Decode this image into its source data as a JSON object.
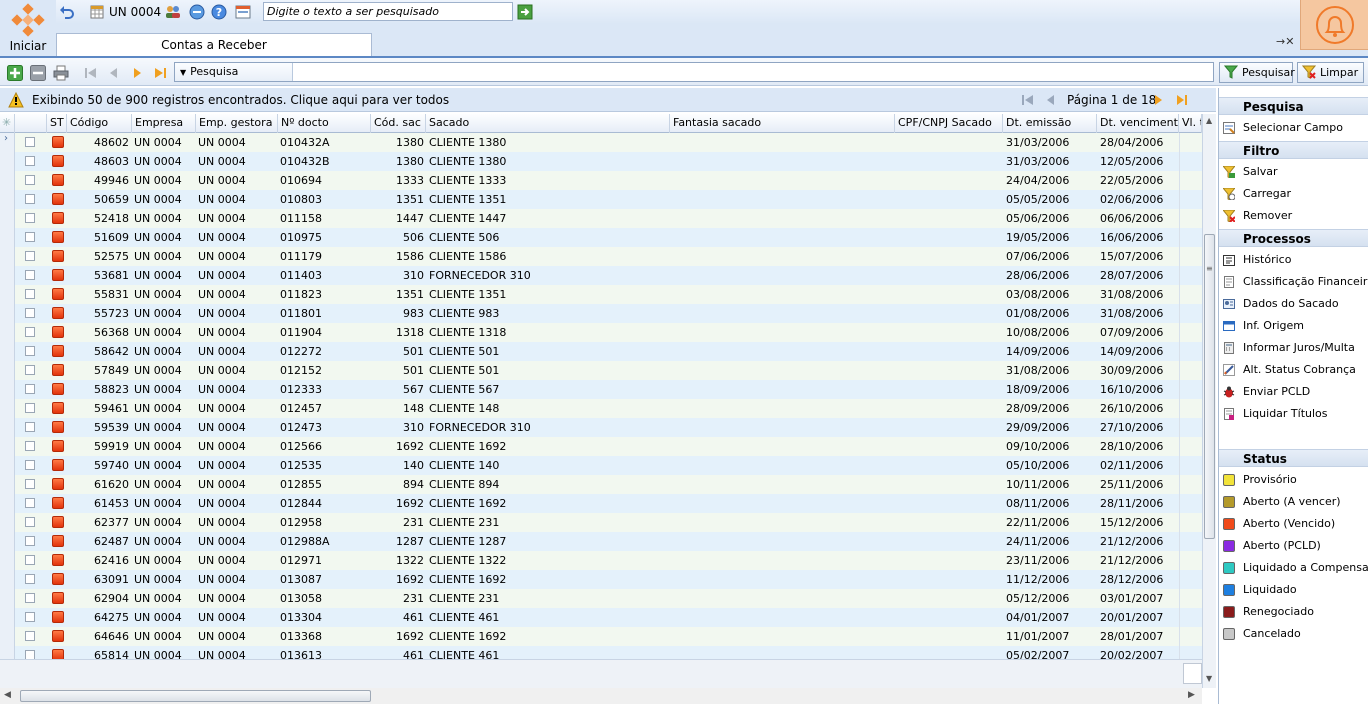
{
  "app": {
    "start_label": "Iniciar",
    "company_unit": "UN 0004",
    "search_placeholder": "Digite o texto a ser pesquisado"
  },
  "tabs": [
    {
      "label": "Contas a Receber",
      "active": true
    }
  ],
  "toolbar": {
    "search_dropdown": "Pesquisa",
    "search_button": "Pesquisar",
    "clear_button": "Limpar"
  },
  "info": {
    "message": "Exibindo 50 de 900 registros encontrados. Clique aqui para ver todos",
    "page": "Página 1 de 18"
  },
  "grid": {
    "headers": {
      "st": "ST",
      "codigo": "Código",
      "empresa": "Empresa",
      "emp_gestora": "Emp. gestora",
      "n_docto": "Nº docto",
      "cod_sac": "Cód. sac",
      "sacado": "Sacado",
      "fantasia": "Fantasia sacado",
      "cpf": "CPF/CNPJ Sacado",
      "emissao": "Dt. emissão",
      "vencimento": "Dt. vencimento",
      "vl": "Vl. t"
    },
    "rows": [
      {
        "codigo": "48602",
        "empresa": "UN 0004",
        "gestora": "UN 0004",
        "docto": "010432A",
        "codsac": "1380",
        "sacado": "CLIENTE  1380",
        "emissao": "31/03/2006",
        "venc": "28/04/2006"
      },
      {
        "codigo": "48603",
        "empresa": "UN 0004",
        "gestora": "UN 0004",
        "docto": "010432B",
        "codsac": "1380",
        "sacado": "CLIENTE  1380",
        "emissao": "31/03/2006",
        "venc": "12/05/2006"
      },
      {
        "codigo": "49946",
        "empresa": "UN 0004",
        "gestora": "UN 0004",
        "docto": "010694",
        "codsac": "1333",
        "sacado": "CLIENTE  1333",
        "emissao": "24/04/2006",
        "venc": "22/05/2006"
      },
      {
        "codigo": "50659",
        "empresa": "UN 0004",
        "gestora": "UN 0004",
        "docto": "010803",
        "codsac": "1351",
        "sacado": "CLIENTE  1351",
        "emissao": "05/05/2006",
        "venc": "02/06/2006"
      },
      {
        "codigo": "52418",
        "empresa": "UN 0004",
        "gestora": "UN 0004",
        "docto": "011158",
        "codsac": "1447",
        "sacado": "CLIENTE  1447",
        "emissao": "05/06/2006",
        "venc": "06/06/2006"
      },
      {
        "codigo": "51609",
        "empresa": "UN 0004",
        "gestora": "UN 0004",
        "docto": "010975",
        "codsac": "506",
        "sacado": "CLIENTE  506",
        "emissao": "19/05/2006",
        "venc": "16/06/2006"
      },
      {
        "codigo": "52575",
        "empresa": "UN 0004",
        "gestora": "UN 0004",
        "docto": "011179",
        "codsac": "1586",
        "sacado": "CLIENTE  1586",
        "emissao": "07/06/2006",
        "venc": "15/07/2006"
      },
      {
        "codigo": "53681",
        "empresa": "UN 0004",
        "gestora": "UN 0004",
        "docto": "011403",
        "codsac": "310",
        "sacado": "FORNECEDOR  310",
        "emissao": "28/06/2006",
        "venc": "28/07/2006"
      },
      {
        "codigo": "55831",
        "empresa": "UN 0004",
        "gestora": "UN 0004",
        "docto": "011823",
        "codsac": "1351",
        "sacado": "CLIENTE  1351",
        "emissao": "03/08/2006",
        "venc": "31/08/2006"
      },
      {
        "codigo": "55723",
        "empresa": "UN 0004",
        "gestora": "UN 0004",
        "docto": "011801",
        "codsac": "983",
        "sacado": "CLIENTE  983",
        "emissao": "01/08/2006",
        "venc": "31/08/2006"
      },
      {
        "codigo": "56368",
        "empresa": "UN 0004",
        "gestora": "UN 0004",
        "docto": "011904",
        "codsac": "1318",
        "sacado": "CLIENTE  1318",
        "emissao": "10/08/2006",
        "venc": "07/09/2006"
      },
      {
        "codigo": "58642",
        "empresa": "UN 0004",
        "gestora": "UN 0004",
        "docto": "012272",
        "codsac": "501",
        "sacado": "CLIENTE  501",
        "emissao": "14/09/2006",
        "venc": "14/09/2006"
      },
      {
        "codigo": "57849",
        "empresa": "UN 0004",
        "gestora": "UN 0004",
        "docto": "012152",
        "codsac": "501",
        "sacado": "CLIENTE  501",
        "emissao": "31/08/2006",
        "venc": "30/09/2006"
      },
      {
        "codigo": "58823",
        "empresa": "UN 0004",
        "gestora": "UN 0004",
        "docto": "012333",
        "codsac": "567",
        "sacado": "CLIENTE  567",
        "emissao": "18/09/2006",
        "venc": "16/10/2006"
      },
      {
        "codigo": "59461",
        "empresa": "UN 0004",
        "gestora": "UN 0004",
        "docto": "012457",
        "codsac": "148",
        "sacado": "CLIENTE  148",
        "emissao": "28/09/2006",
        "venc": "26/10/2006"
      },
      {
        "codigo": "59539",
        "empresa": "UN 0004",
        "gestora": "UN 0004",
        "docto": "012473",
        "codsac": "310",
        "sacado": "FORNECEDOR  310",
        "emissao": "29/09/2006",
        "venc": "27/10/2006"
      },
      {
        "codigo": "59919",
        "empresa": "UN 0004",
        "gestora": "UN 0004",
        "docto": "012566",
        "codsac": "1692",
        "sacado": "CLIENTE  1692",
        "emissao": "09/10/2006",
        "venc": "28/10/2006"
      },
      {
        "codigo": "59740",
        "empresa": "UN 0004",
        "gestora": "UN 0004",
        "docto": "012535",
        "codsac": "140",
        "sacado": "CLIENTE  140",
        "emissao": "05/10/2006",
        "venc": "02/11/2006"
      },
      {
        "codigo": "61620",
        "empresa": "UN 0004",
        "gestora": "UN 0004",
        "docto": "012855",
        "codsac": "894",
        "sacado": "CLIENTE  894",
        "emissao": "10/11/2006",
        "venc": "25/11/2006"
      },
      {
        "codigo": "61453",
        "empresa": "UN 0004",
        "gestora": "UN 0004",
        "docto": "012844",
        "codsac": "1692",
        "sacado": "CLIENTE  1692",
        "emissao": "08/11/2006",
        "venc": "28/11/2006"
      },
      {
        "codigo": "62377",
        "empresa": "UN 0004",
        "gestora": "UN 0004",
        "docto": "012958",
        "codsac": "231",
        "sacado": "CLIENTE  231",
        "emissao": "22/11/2006",
        "venc": "15/12/2006"
      },
      {
        "codigo": "62487",
        "empresa": "UN 0004",
        "gestora": "UN 0004",
        "docto": "012988A",
        "codsac": "1287",
        "sacado": "CLIENTE  1287",
        "emissao": "24/11/2006",
        "venc": "21/12/2006"
      },
      {
        "codigo": "62416",
        "empresa": "UN 0004",
        "gestora": "UN 0004",
        "docto": "012971",
        "codsac": "1322",
        "sacado": "CLIENTE  1322",
        "emissao": "23/11/2006",
        "venc": "21/12/2006"
      },
      {
        "codigo": "63091",
        "empresa": "UN 0004",
        "gestora": "UN 0004",
        "docto": "013087",
        "codsac": "1692",
        "sacado": "CLIENTE  1692",
        "emissao": "11/12/2006",
        "venc": "28/12/2006"
      },
      {
        "codigo": "62904",
        "empresa": "UN 0004",
        "gestora": "UN 0004",
        "docto": "013058",
        "codsac": "231",
        "sacado": "CLIENTE  231",
        "emissao": "05/12/2006",
        "venc": "03/01/2007"
      },
      {
        "codigo": "64275",
        "empresa": "UN 0004",
        "gestora": "UN 0004",
        "docto": "013304",
        "codsac": "461",
        "sacado": "CLIENTE  461",
        "emissao": "04/01/2007",
        "venc": "20/01/2007"
      },
      {
        "codigo": "64646",
        "empresa": "UN 0004",
        "gestora": "UN 0004",
        "docto": "013368",
        "codsac": "1692",
        "sacado": "CLIENTE  1692",
        "emissao": "11/01/2007",
        "venc": "28/01/2007"
      },
      {
        "codigo": "65814",
        "empresa": "UN 0004",
        "gestora": "UN 0004",
        "docto": "013613",
        "codsac": "461",
        "sacado": "CLIENTE  461",
        "emissao": "05/02/2007",
        "venc": "20/02/2007"
      }
    ]
  },
  "sidebar": {
    "pesquisa_title": "Pesquisa",
    "pesquisa_items": [
      {
        "label": "Selecionar Campo",
        "icon": "select-field-icon"
      }
    ],
    "filtro_title": "Filtro",
    "filtro_items": [
      {
        "label": "Salvar",
        "icon": "filter-save-icon"
      },
      {
        "label": "Carregar",
        "icon": "filter-load-icon"
      },
      {
        "label": "Remover",
        "icon": "filter-remove-icon"
      }
    ],
    "processos_title": "Processos",
    "processos_items": [
      {
        "label": "Histórico",
        "icon": "history-icon"
      },
      {
        "label": "Classificação Financeira",
        "icon": "classification-icon"
      },
      {
        "label": "Dados do Sacado",
        "icon": "contact-card-icon"
      },
      {
        "label": "Inf. Origem",
        "icon": "origin-window-icon"
      },
      {
        "label": "Informar Juros/Multa",
        "icon": "calculator-icon"
      },
      {
        "label": "Alt. Status Cobrança",
        "icon": "edit-pencil-icon"
      },
      {
        "label": "Enviar PCLD",
        "icon": "bug-icon"
      },
      {
        "label": "Liquidar Títulos",
        "icon": "liquidate-icon"
      }
    ],
    "status_title": "Status",
    "status_items": [
      {
        "label": "Provisório",
        "color": "#f2e33a"
      },
      {
        "label": "Aberto (A vencer)",
        "color": "#b49a2a"
      },
      {
        "label": "Aberto (Vencido)",
        "color": "#f04a1a"
      },
      {
        "label": "Aberto (PCLD)",
        "color": "#8a2be2"
      },
      {
        "label": "Liquidado a Compensar",
        "color": "#2ec9c2"
      },
      {
        "label": "Liquidado",
        "color": "#1e7fe0"
      },
      {
        "label": "Renegociado",
        "color": "#8a1c1c"
      },
      {
        "label": "Cancelado",
        "color": "#c8c8c8"
      }
    ]
  }
}
